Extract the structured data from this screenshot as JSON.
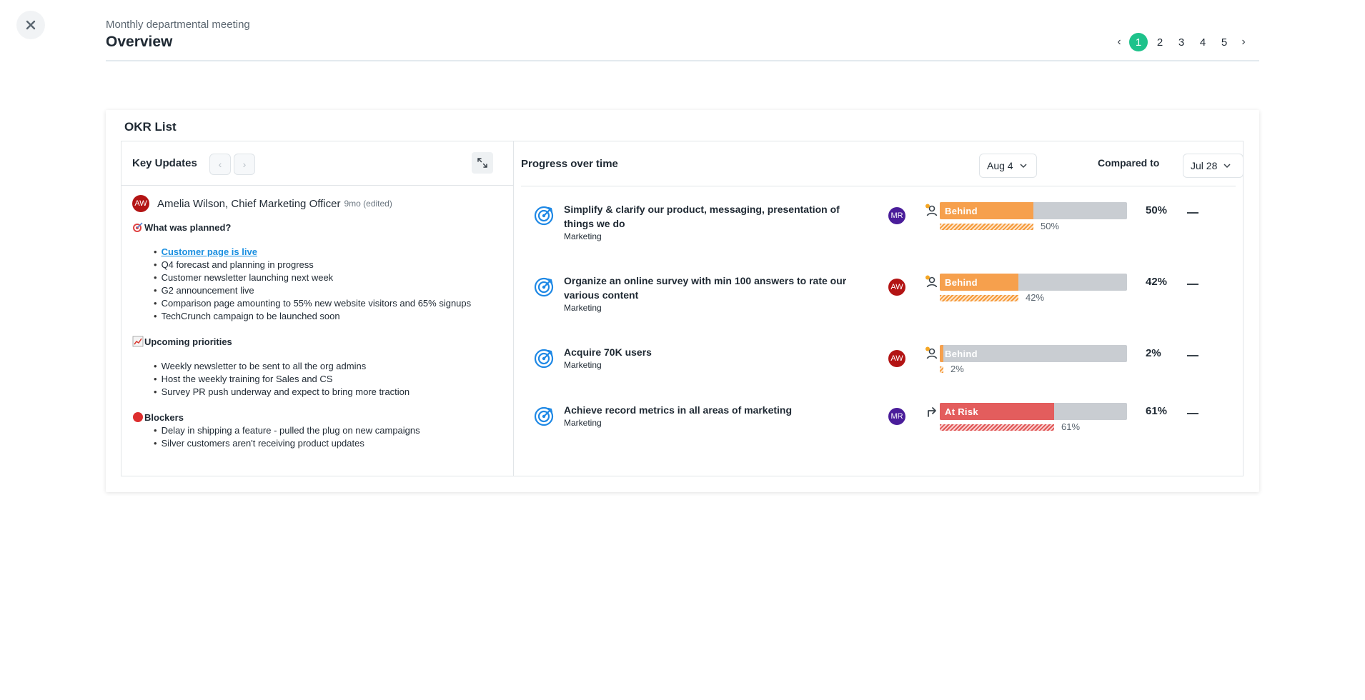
{
  "header": {
    "subtitle": "Monthly departmental meeting",
    "title": "Overview",
    "pages": [
      "1",
      "2",
      "3",
      "4",
      "5"
    ],
    "active_page": "1",
    "prev": "‹",
    "next": "›"
  },
  "card": {
    "title": "OKR List"
  },
  "key_updates": {
    "label": "Key Updates",
    "prev": "‹",
    "next": "›",
    "author": {
      "initials": "AW",
      "name": "Amelia Wilson, Chief Marketing Officer",
      "time": "9mo (edited)"
    },
    "sections": {
      "planned": {
        "title": "What was planned?",
        "link": "Customer page is live",
        "items": [
          "Q4 forecast and planning in progress",
          "Customer newsletter launching next week",
          "G2 announcement live",
          "Comparison page amounting to 55% new website visitors and 65% signups",
          "TechCrunch campaign to be launched soon"
        ]
      },
      "upcoming": {
        "title": "Upcoming priorities",
        "items": [
          "Weekly newsletter to be sent to all the org admins",
          "Host the weekly training for Sales and CS",
          "Survey PR push underway and expect to bring more traction"
        ]
      },
      "blockers": {
        "title": "Blockers",
        "items": [
          "Delay in shipping a feature - pulled the plug on new campaigns",
          "Silver customers aren't receiving product updates"
        ]
      }
    }
  },
  "progress": {
    "label": "Progress over time",
    "date": "Aug 4",
    "compared_label": "Compared to",
    "compare_date": "Jul 28",
    "colors": {
      "behind": "#f6a04d",
      "at_risk": "#e35d5d",
      "track": "#c9cdd2"
    },
    "okrs": [
      {
        "title": "Simplify & clarify our product, messaging, presentation of things we do",
        "team": "Marketing",
        "owner": "MR",
        "status": "Behind",
        "progress": 50,
        "previous_progress": 50,
        "pct": "50%",
        "prev_pct": "50%"
      },
      {
        "title": "Organize an online survey with min 100 answers to rate our various content",
        "team": "Marketing",
        "owner": "AW",
        "status": "Behind",
        "progress": 42,
        "previous_progress": 42,
        "pct": "42%",
        "prev_pct": "42%"
      },
      {
        "title": "Acquire 70K users",
        "team": "Marketing",
        "owner": "AW",
        "status": "Behind",
        "progress": 2,
        "previous_progress": 2,
        "pct": "2%",
        "prev_pct": "2%"
      },
      {
        "title": "Achieve record metrics in all areas of marketing",
        "team": "Marketing",
        "owner": "MR",
        "status": "At Risk",
        "progress": 61,
        "previous_progress": 61,
        "pct": "61%",
        "prev_pct": "61%"
      }
    ]
  }
}
